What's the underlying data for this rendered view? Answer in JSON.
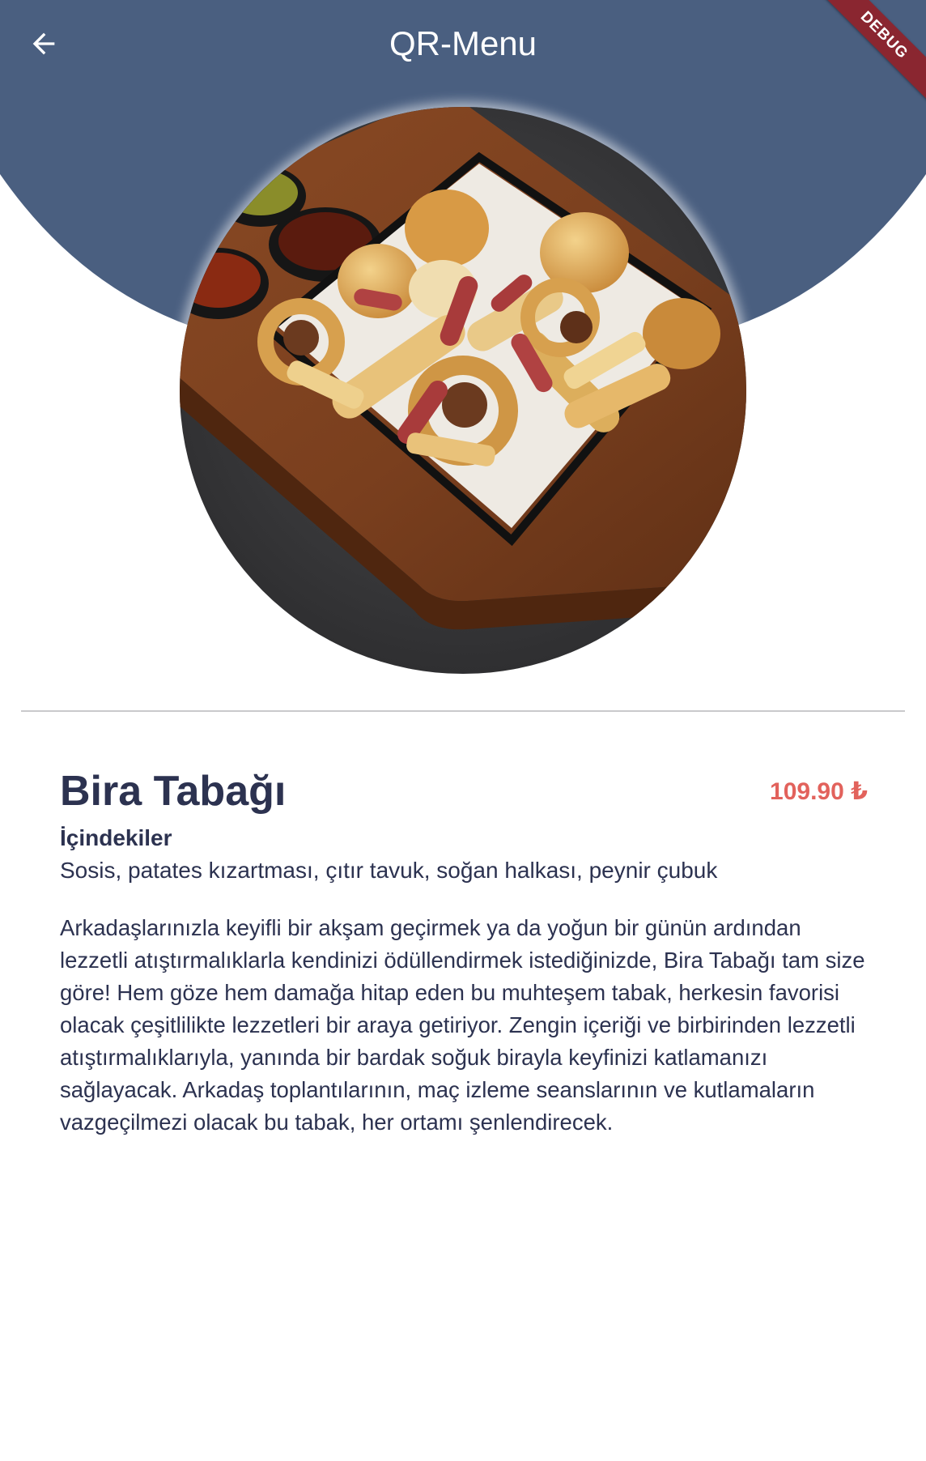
{
  "app_bar": {
    "title": "QR-Menu",
    "back_icon": "arrow-left-icon",
    "background_color": "#4a5f80",
    "debug_banner": "DEBUG"
  },
  "dish": {
    "photo": "beer-snack-platter-photo",
    "name": "Bira Tabağı",
    "price": "109.90 ₺",
    "ingredients_heading": "İçindekiler",
    "ingredients": "Sosis, patates kızartması, çıtır tavuk, soğan halkası, peynir çubuk",
    "description": "Arkadaşlarınızla keyifli bir akşam geçirmek ya da yoğun bir günün ardından lezzetli atıştırmalıklarla kendinizi ödüllendirmek istediğinizde, Bira Tabağı tam size göre! Hem göze hem damağa hitap eden bu muhteşem tabak, herkesin favorisi olacak çeşitlilikte lezzetleri bir araya getiriyor. Zengin içeriği ve birbirinden lezzetli atıştırmalıklarıyla, yanında bir bardak soğuk birayla keyfinizi katlamanızı sağlayacak. Arkadaş toplantılarının, maç izleme seanslarının ve kutlamaların vazgeçilmezi olacak bu tabak, her ortamı şenlendirecek."
  },
  "colors": {
    "text": "#2c3250",
    "price": "#e2625c",
    "divider": "#c9c9cc"
  }
}
